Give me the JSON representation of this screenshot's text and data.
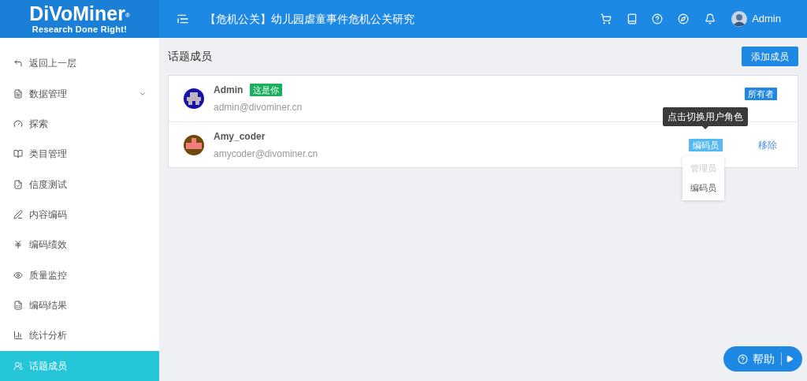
{
  "header": {
    "logo": "DiVoMiner",
    "logo_mark": "®",
    "slogan": "Research Done Right!",
    "project_title": "【危机公关】幼儿园虐童事件危机公关研究",
    "user": "Admin"
  },
  "sidebar": {
    "items": [
      {
        "label": "返回上一层",
        "selected": false
      },
      {
        "label": "数据管理",
        "selected": false,
        "expanded": false
      },
      {
        "label": "探索",
        "selected": false
      },
      {
        "label": "类目管理",
        "selected": false
      },
      {
        "label": "信度测试",
        "selected": false
      },
      {
        "label": "内容编码",
        "selected": false
      },
      {
        "label": "编码绩效",
        "selected": false
      },
      {
        "label": "质量监控",
        "selected": false
      },
      {
        "label": "编码结果",
        "selected": false
      },
      {
        "label": "统计分析",
        "selected": false
      },
      {
        "label": "话题成员",
        "selected": true
      }
    ]
  },
  "page": {
    "title": "话题成员",
    "add_button": "添加成员"
  },
  "members": [
    {
      "name": "Admin",
      "badge": "这是你",
      "email": "admin@divominer.cn",
      "role": "所有者",
      "kind": "owner"
    },
    {
      "name": "Amy_coder",
      "email": "amycoder@divominer.cn",
      "role": "编码员",
      "kind": "editable",
      "remove": "移除"
    }
  ],
  "tooltip": "点击切换用户角色",
  "role_menu": [
    {
      "label": "管理员",
      "disabled": true
    },
    {
      "label": "编码员",
      "disabled": false
    }
  ],
  "help_button": "帮助"
}
